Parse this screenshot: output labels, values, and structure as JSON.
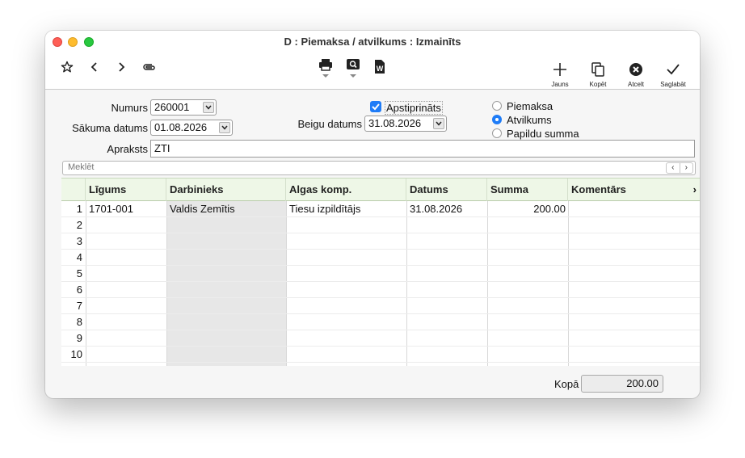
{
  "window": {
    "title": "D : Piemaksa / atvilkums : Izmainīts"
  },
  "toolbar": {
    "left_icons": [
      "star-icon",
      "chevron-left-icon",
      "chevron-right-icon",
      "paperclip-icon"
    ],
    "center_icons": [
      "printer-icon",
      "search-doc-icon",
      "word-export-icon"
    ],
    "new_label": "Jauns",
    "copy_label": "Kopēt",
    "cancel_label": "Atcelt",
    "save_label": "Saglabāt"
  },
  "form": {
    "numurs_label": "Numurs",
    "numurs_value": "260001",
    "sakuma_label": "Sākuma datums",
    "sakuma_value": "01.08.2026",
    "beigu_label": "Beigu datums",
    "beigu_value": "31.08.2026",
    "apstiprinats_label": "Apstiprināts",
    "apstiprinats_checked": true,
    "apraksts_label": "Apraksts",
    "apraksts_value": "ZTI",
    "type_options": [
      {
        "label": "Piemaksa",
        "selected": false
      },
      {
        "label": "Atvilkums",
        "selected": true
      },
      {
        "label": "Papildu summa",
        "selected": false
      }
    ]
  },
  "search": {
    "placeholder": "Meklēt",
    "prev": "‹",
    "next": "›"
  },
  "table": {
    "columns": [
      "Līgums",
      "Darbinieks",
      "Algas komp.",
      "Datums",
      "Summa",
      "Komentārs"
    ],
    "more_indicator": "›",
    "rows": [
      {
        "n": "1",
        "ligums": "1701-001",
        "darbinieks": "Valdis Zemītis",
        "algas": "Tiesu izpildītājs",
        "datums": "31.08.2026",
        "summa": "200.00",
        "komentars": ""
      },
      {
        "n": "2",
        "ligums": "",
        "darbinieks": "",
        "algas": "",
        "datums": "",
        "summa": "",
        "komentars": ""
      },
      {
        "n": "3",
        "ligums": "",
        "darbinieks": "",
        "algas": "",
        "datums": "",
        "summa": "",
        "komentars": ""
      },
      {
        "n": "4",
        "ligums": "",
        "darbinieks": "",
        "algas": "",
        "datums": "",
        "summa": "",
        "komentars": ""
      },
      {
        "n": "5",
        "ligums": "",
        "darbinieks": "",
        "algas": "",
        "datums": "",
        "summa": "",
        "komentars": ""
      },
      {
        "n": "6",
        "ligums": "",
        "darbinieks": "",
        "algas": "",
        "datums": "",
        "summa": "",
        "komentars": ""
      },
      {
        "n": "7",
        "ligums": "",
        "darbinieks": "",
        "algas": "",
        "datums": "",
        "summa": "",
        "komentars": ""
      },
      {
        "n": "8",
        "ligums": "",
        "darbinieks": "",
        "algas": "",
        "datums": "",
        "summa": "",
        "komentars": ""
      },
      {
        "n": "9",
        "ligums": "",
        "darbinieks": "",
        "algas": "",
        "datums": "",
        "summa": "",
        "komentars": ""
      },
      {
        "n": "10",
        "ligums": "",
        "darbinieks": "",
        "algas": "",
        "datums": "",
        "summa": "",
        "komentars": ""
      }
    ]
  },
  "footer": {
    "total_label": "Kopā",
    "total_value": "200.00"
  },
  "colors": {
    "accent": "#1f7cf7",
    "header_bg": "#eef7e7",
    "readonly_col": "#e7e7e7"
  }
}
